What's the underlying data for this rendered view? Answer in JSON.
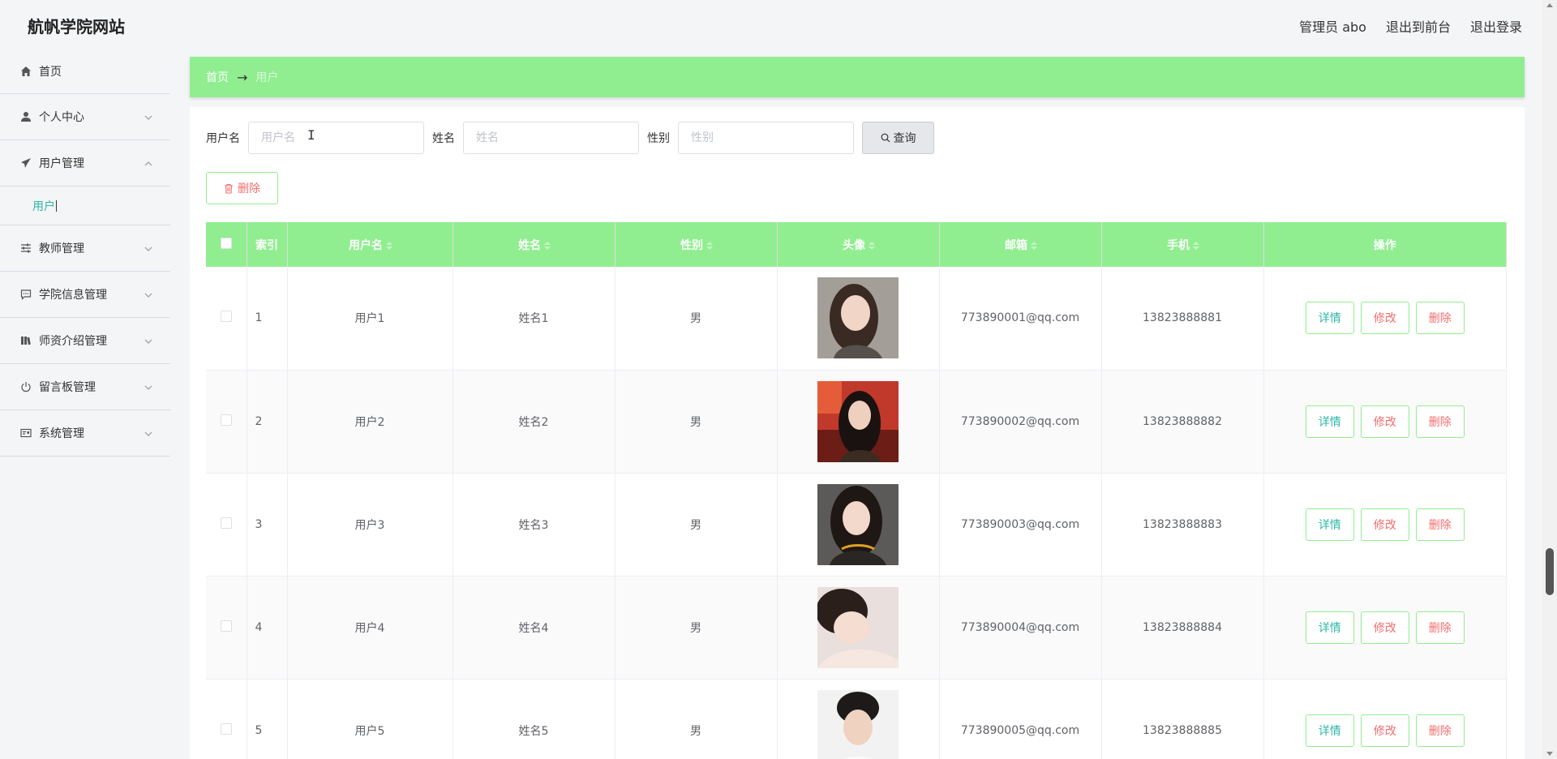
{
  "header": {
    "site_title": "航帆学院网站",
    "admin_label": "管理员 abo",
    "back_to_front": "退出到前台",
    "logout": "退出登录"
  },
  "sidebar": {
    "items": [
      {
        "label": "首页",
        "icon": "home-icon"
      },
      {
        "label": "个人中心",
        "icon": "user-icon"
      },
      {
        "label": "用户管理",
        "icon": "paper-plane-icon",
        "expanded": true
      },
      {
        "label": "教师管理",
        "icon": "sliders-icon"
      },
      {
        "label": "学院信息管理",
        "icon": "chat-icon"
      },
      {
        "label": "师资介绍管理",
        "icon": "books-icon"
      },
      {
        "label": "留言板管理",
        "icon": "power-icon"
      },
      {
        "label": "系统管理",
        "icon": "id-card-icon"
      }
    ],
    "submenu_active": "用户"
  },
  "breadcrumb": {
    "home": "首页",
    "separator": "→",
    "current": "用户"
  },
  "search": {
    "username_label": "用户名",
    "username_placeholder": "用户名",
    "name_label": "姓名",
    "name_placeholder": "姓名",
    "gender_label": "性别",
    "gender_placeholder": "性别",
    "query_button": "查询"
  },
  "batch_delete_label": "删除",
  "table": {
    "columns": [
      "索引",
      "用户名",
      "姓名",
      "性别",
      "头像",
      "邮箱",
      "手机",
      "操作"
    ],
    "rows": [
      {
        "index": "1",
        "username": "用户1",
        "name": "姓名1",
        "gender": "男",
        "email": "773890001@qq.com",
        "phone": "13823888881"
      },
      {
        "index": "2",
        "username": "用户2",
        "name": "姓名2",
        "gender": "男",
        "email": "773890002@qq.com",
        "phone": "13823888882"
      },
      {
        "index": "3",
        "username": "用户3",
        "name": "姓名3",
        "gender": "男",
        "email": "773890003@qq.com",
        "phone": "13823888883"
      },
      {
        "index": "4",
        "username": "用户4",
        "name": "姓名4",
        "gender": "男",
        "email": "773890004@qq.com",
        "phone": "13823888884"
      },
      {
        "index": "5",
        "username": "用户5",
        "name": "姓名5",
        "gender": "男",
        "email": "773890005@qq.com",
        "phone": "13823888885"
      }
    ],
    "actions": {
      "detail": "详情",
      "edit": "修改",
      "delete": "删除"
    }
  },
  "colors": {
    "accent_green": "#90ee90",
    "teal_text": "#2bb8a4",
    "danger_text": "#f56c6c"
  }
}
